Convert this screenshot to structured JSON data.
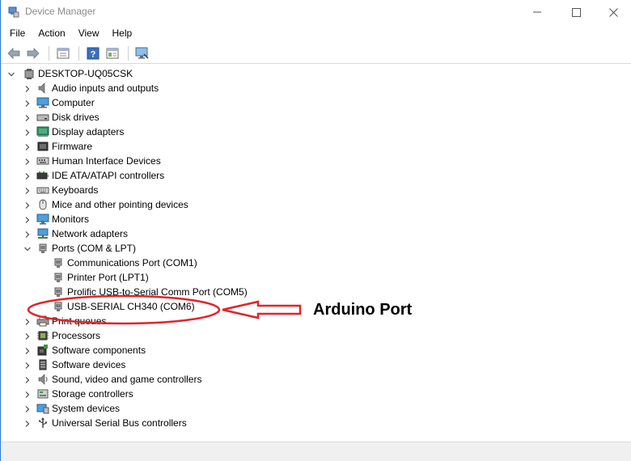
{
  "window": {
    "title": "Device Manager",
    "controls": {
      "minimize": "minimize-icon",
      "maximize": "maximize-icon",
      "close": "close-icon"
    }
  },
  "menu": [
    "File",
    "Action",
    "View",
    "Help"
  ],
  "toolbar": [
    "back-arrow-icon",
    "forward-arrow-icon",
    "properties-icon",
    "help-icon",
    "view-panel-icon",
    "monitor-scan-icon"
  ],
  "tree": {
    "root": "DESKTOP-UQ05CSK",
    "categories": [
      {
        "label": "Audio inputs and outputs",
        "icon": "speaker-icon",
        "expanded": false
      },
      {
        "label": "Computer",
        "icon": "computer-icon",
        "expanded": false
      },
      {
        "label": "Disk drives",
        "icon": "disk-drive-icon",
        "expanded": false
      },
      {
        "label": "Display adapters",
        "icon": "display-adapter-icon",
        "expanded": false
      },
      {
        "label": "Firmware",
        "icon": "firmware-icon",
        "expanded": false
      },
      {
        "label": "Human Interface Devices",
        "icon": "hid-icon",
        "expanded": false
      },
      {
        "label": "IDE ATA/ATAPI controllers",
        "icon": "ide-controller-icon",
        "expanded": false
      },
      {
        "label": "Keyboards",
        "icon": "keyboard-icon",
        "expanded": false
      },
      {
        "label": "Mice and other pointing devices",
        "icon": "mouse-icon",
        "expanded": false
      },
      {
        "label": "Monitors",
        "icon": "monitor-icon",
        "expanded": false
      },
      {
        "label": "Network adapters",
        "icon": "network-icon",
        "expanded": false
      },
      {
        "label": "Ports (COM & LPT)",
        "icon": "port-icon",
        "expanded": true,
        "children": [
          {
            "label": "Communications Port (COM1)",
            "icon": "port-icon"
          },
          {
            "label": "Printer Port (LPT1)",
            "icon": "port-icon"
          },
          {
            "label": "Prolific USB-to-Serial Comm Port (COM5)",
            "icon": "port-icon"
          },
          {
            "label": "USB-SERIAL CH340 (COM6)",
            "icon": "port-icon"
          }
        ]
      },
      {
        "label": "Print queues",
        "icon": "printer-icon",
        "expanded": false
      },
      {
        "label": "Processors",
        "icon": "processor-icon",
        "expanded": false
      },
      {
        "label": "Software components",
        "icon": "software-component-icon",
        "expanded": false
      },
      {
        "label": "Software devices",
        "icon": "software-device-icon",
        "expanded": false
      },
      {
        "label": "Sound, video and game controllers",
        "icon": "sound-icon",
        "expanded": false
      },
      {
        "label": "Storage controllers",
        "icon": "storage-icon",
        "expanded": false
      },
      {
        "label": "System devices",
        "icon": "system-device-icon",
        "expanded": false
      },
      {
        "label": "Universal Serial Bus controllers",
        "icon": "usb-icon",
        "expanded": false
      }
    ]
  },
  "annotation": {
    "text": "Arduino Port",
    "color": "#e0252a"
  }
}
